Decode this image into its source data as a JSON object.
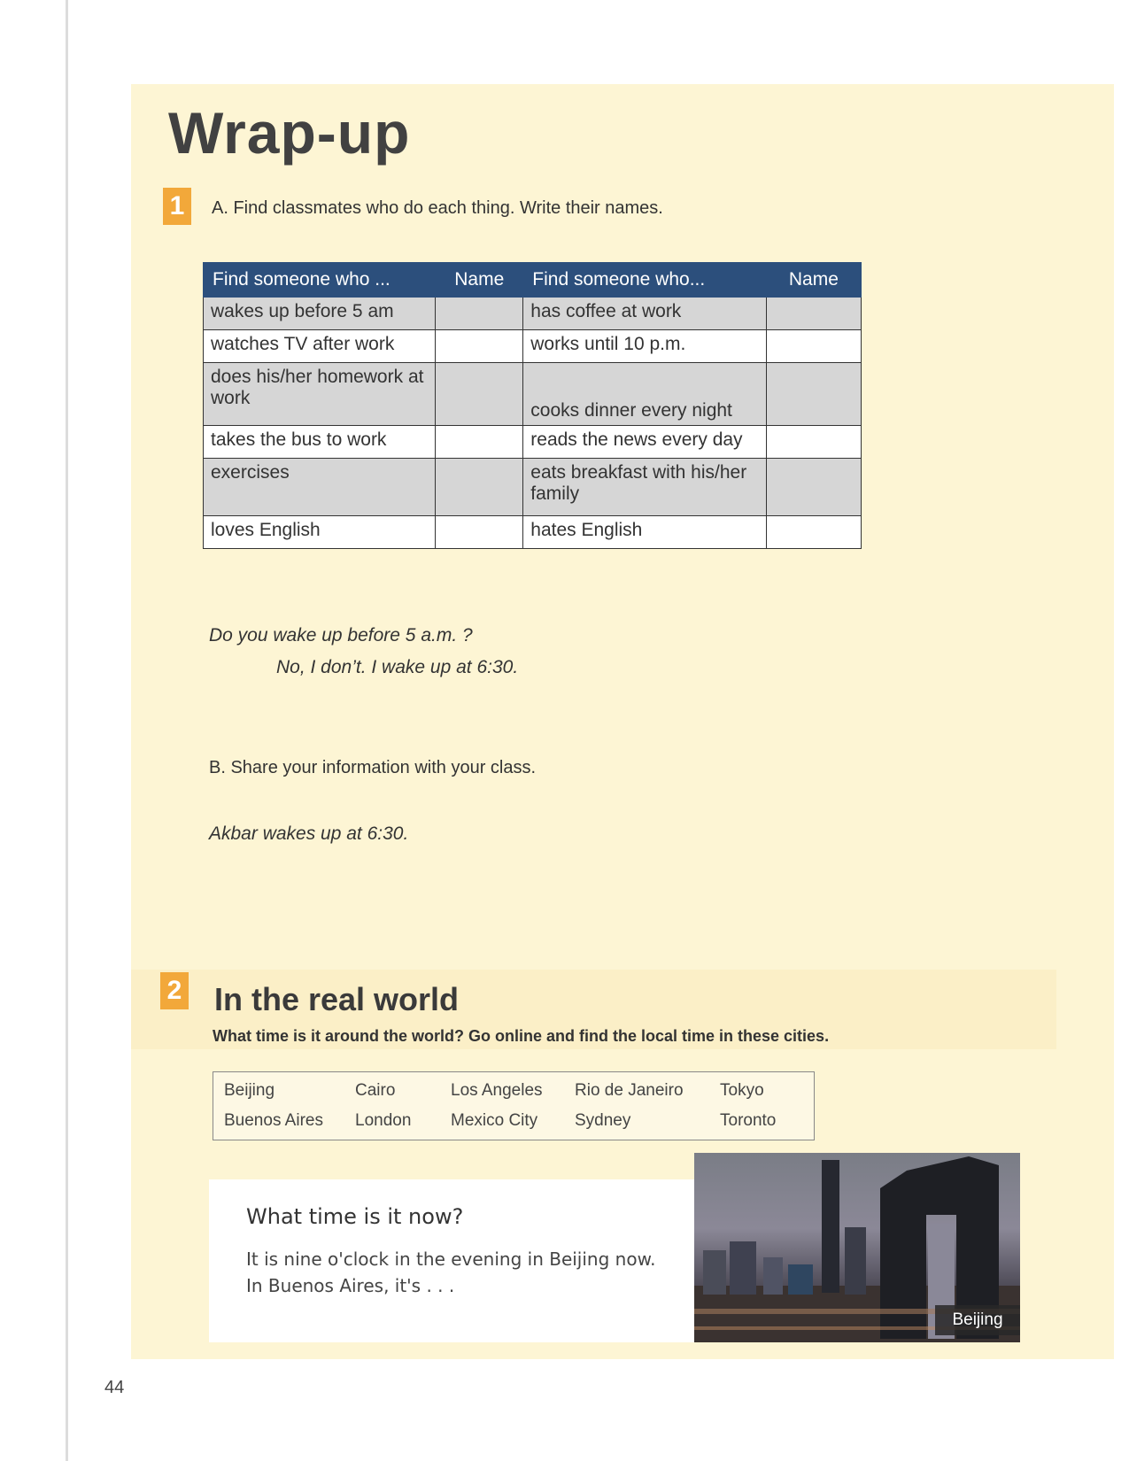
{
  "page": {
    "title": "Wrap-up",
    "page_number": "44"
  },
  "section1": {
    "badge": "1",
    "instruction_a": "A. Find classmates who do each thing. Write their names.",
    "table": {
      "headers": [
        "Find someone who ...",
        "Name",
        "Find someone who...",
        "Name"
      ],
      "rows": [
        {
          "left": "wakes up before 5 am",
          "right": "has coffee at work"
        },
        {
          "left": "watches TV after work",
          "right": "works until 10 p.m."
        },
        {
          "left": "does his/her homework at work",
          "right": "cooks dinner every night"
        },
        {
          "left": "takes the bus to work",
          "right": "reads the news every day"
        },
        {
          "left": "exercises",
          "right": "eats breakfast with his/her family"
        },
        {
          "left": "loves English",
          "right": "hates English"
        }
      ]
    },
    "dialog_q": "Do you wake up before 5 a.m. ?",
    "dialog_a": "No, I don’t. I wake up at 6:30.",
    "instruction_b": "B. Share your information with your class.",
    "example_b": "Akbar wakes up at 6:30."
  },
  "section2": {
    "badge": "2",
    "title": "In the real world",
    "instruction": "What time is it around the world? Go online and find the local time in these cities.",
    "cities": [
      "Beijing",
      "Cairo",
      "Los Angeles",
      "Rio de Janeiro",
      "Tokyo",
      "Buenos Aires",
      "London",
      "Mexico City",
      "Sydney",
      "Toronto"
    ],
    "note": {
      "title": "What time is it now?",
      "line1": "It is nine o'clock in the evening in Beijing now.",
      "line2": "In Buenos Aires, it's . . ."
    },
    "photo_label": "Beijing"
  }
}
